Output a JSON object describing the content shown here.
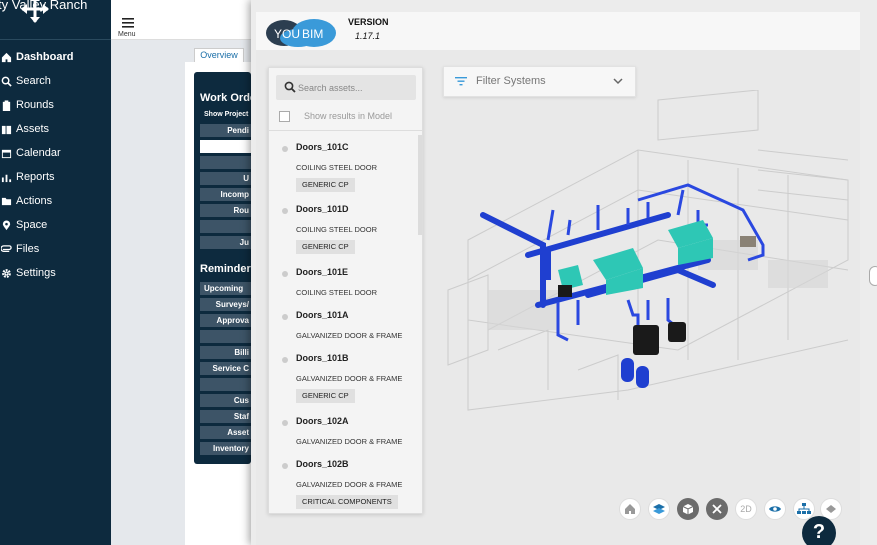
{
  "app": {
    "brand_text": "ty Valley Ranch",
    "menu_label": "Menu"
  },
  "sidebar": {
    "items": [
      {
        "label": "Dashboard",
        "icon": "home-icon"
      },
      {
        "label": "Search",
        "icon": "search-icon"
      },
      {
        "label": "Rounds",
        "icon": "clipboard-icon"
      },
      {
        "label": "Assets",
        "icon": "book-icon"
      },
      {
        "label": "Calendar",
        "icon": "calendar-icon"
      },
      {
        "label": "Reports",
        "icon": "bar-chart-icon"
      },
      {
        "label": "Actions",
        "icon": "folder-icon"
      },
      {
        "label": "Space",
        "icon": "map-pin-icon"
      },
      {
        "label": "Files",
        "icon": "paperclip-icon"
      },
      {
        "label": "Settings",
        "icon": "gear-icon"
      }
    ]
  },
  "overview": {
    "tab": "Overview",
    "work_orders_heading": "Work Orde",
    "show_projects": "Show Project",
    "wo_buttons": [
      "Pendi",
      "",
      "",
      "U",
      "Incomp",
      "Rou",
      "",
      "Ju"
    ],
    "reminders_heading": "Reminder",
    "reminder_buttons": [
      "Upcoming",
      "Surveys/",
      "Approva",
      "",
      "Billi",
      "Service C",
      "",
      "Cus",
      "Staf",
      "Asset",
      "Inventory"
    ]
  },
  "modal": {
    "logo_left": "YOU",
    "logo_right": "BIM",
    "version_label": "VERSION",
    "version_value": "1.17.1",
    "search_placeholder": "Search assets...",
    "show_results_label": "Show results in Model",
    "filter_label": "Filter Systems",
    "assets": [
      {
        "name": "Doors_101C",
        "desc": "COILING STEEL DOOR",
        "tag": "GENERIC CP"
      },
      {
        "name": "Doors_101D",
        "desc": "COILING STEEL DOOR",
        "tag": "GENERIC CP"
      },
      {
        "name": "Doors_101E",
        "desc": "COILING STEEL DOOR",
        "tag": ""
      },
      {
        "name": "Doors_101A",
        "desc": "GALVANIZED DOOR & FRAME",
        "tag": ""
      },
      {
        "name": "Doors_101B",
        "desc": "GALVANIZED DOOR & FRAME",
        "tag": "GENERIC CP"
      },
      {
        "name": "Doors_102A",
        "desc": "GALVANIZED DOOR & FRAME",
        "tag": ""
      },
      {
        "name": "Doors_102B",
        "desc": "GALVANIZED DOOR & FRAME",
        "tag": "CRITICAL COMPONENTS"
      }
    ],
    "toolbar": [
      {
        "icon": "home-icon",
        "label": ""
      },
      {
        "icon": "layers-icon",
        "label": ""
      },
      {
        "icon": "cube-icon",
        "label": ""
      },
      {
        "icon": "scissors-icon",
        "label": ""
      },
      {
        "icon": "view-2d-icon",
        "label": "2D"
      },
      {
        "icon": "eye-icon",
        "label": ""
      },
      {
        "icon": "hierarchy-icon",
        "label": ""
      },
      {
        "icon": "collapse-icon",
        "label": ""
      }
    ],
    "help_label": "?"
  },
  "colors": {
    "sidebar": "#0d2a3e",
    "accent_blue": "#1b6fa8",
    "pipe_blue": "#1f3fd0",
    "equipment_teal": "#2ec7b5"
  }
}
